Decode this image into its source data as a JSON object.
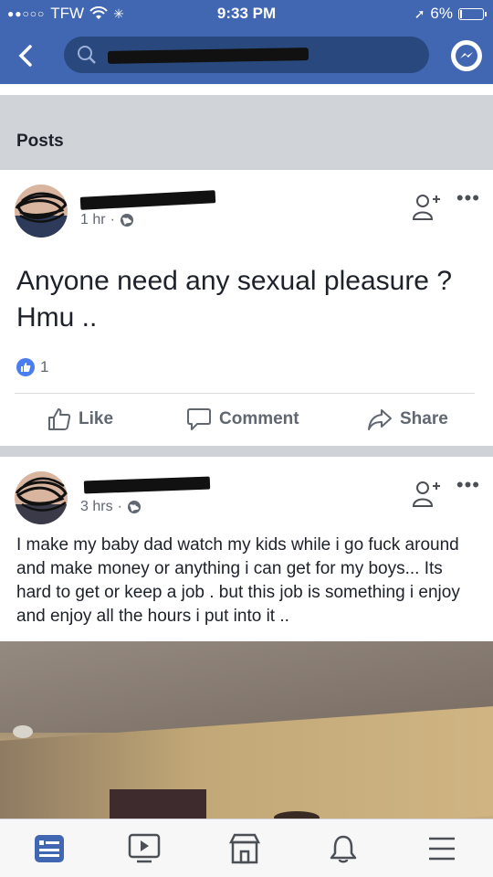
{
  "status_bar": {
    "carrier": "TFW",
    "time": "9:33 PM",
    "battery": "6%",
    "battery_level": 0.06
  },
  "nav": {
    "back_icon": "chevron-left-icon",
    "search_icon": "search-icon",
    "messenger_icon": "messenger-icon"
  },
  "section": {
    "title": "Posts"
  },
  "posts": [
    {
      "time": "1 hr",
      "privacy_icon": "globe-icon",
      "text": "Anyone need any sexual pleasure ? Hmu ..",
      "reaction_count": "1",
      "actions": {
        "like": "Like",
        "comment": "Comment",
        "share": "Share"
      }
    },
    {
      "time": "3 hrs",
      "privacy_icon": "globe-icon",
      "text": "I make my baby dad watch my kids while i go fuck around and make money or anything i can get for my boys... Its hard to get or keep a job . but this job is something i enjoy and enjoy all the hours i put into it .."
    }
  ],
  "bottom_nav": [
    "news-feed-icon",
    "watch-icon",
    "marketplace-icon",
    "notifications-icon",
    "menu-icon"
  ],
  "colors": {
    "brand": "#4267b2",
    "like_blue": "#4a7ef0"
  }
}
